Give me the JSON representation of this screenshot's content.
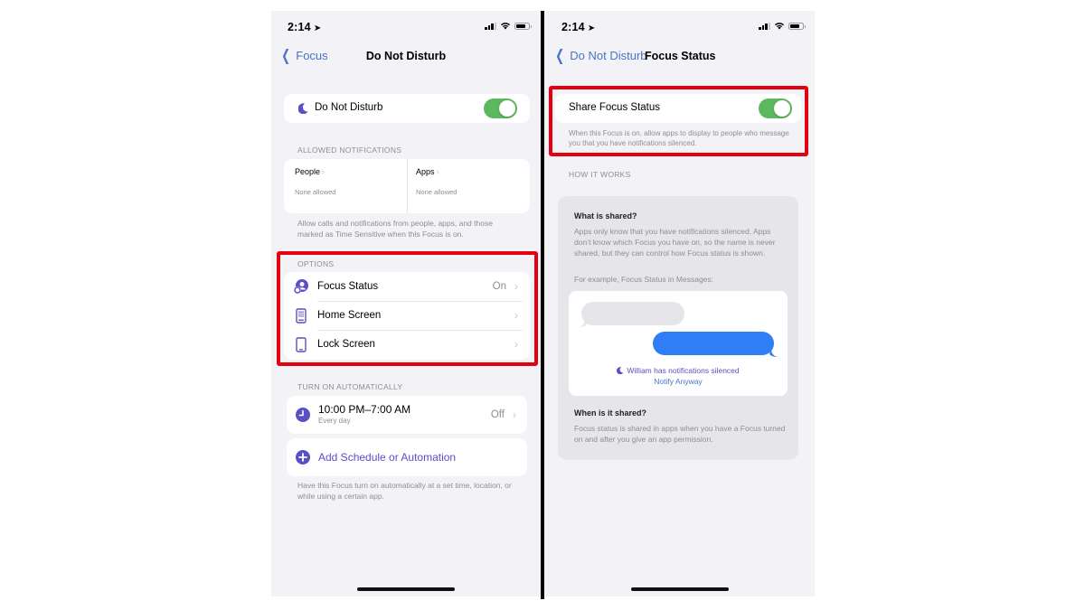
{
  "left_screen": {
    "status_bar": {
      "time": "2:14"
    },
    "nav": {
      "back_label": "Focus",
      "title": "Do Not Disturb"
    },
    "dnd_toggle": {
      "label": "Do Not Disturb",
      "on": true
    },
    "allowed_notifications": {
      "header": "ALLOWED NOTIFICATIONS",
      "people": {
        "label": "People",
        "value": "None allowed"
      },
      "apps": {
        "label": "Apps",
        "value": "None allowed"
      },
      "footer": "Allow calls and notifications from people, apps, and those marked as Time Sensitive when this Focus is on."
    },
    "options": {
      "header": "OPTIONS",
      "items": [
        {
          "label": "Focus Status",
          "value": "On",
          "icon": "focus-status-icon"
        },
        {
          "label": "Home Screen",
          "value": "",
          "icon": "home-screen-icon"
        },
        {
          "label": "Lock Screen",
          "value": "",
          "icon": "lock-screen-icon"
        }
      ]
    },
    "turn_on_automatically": {
      "header": "TURN ON AUTOMATICALLY",
      "schedule": {
        "title": "10:00 PM–7:00 AM",
        "subtitle": "Every day",
        "value": "Off"
      },
      "add_label": "Add Schedule or Automation",
      "footer": "Have this Focus turn on automatically at a set time, location, or while using a certain app."
    }
  },
  "right_screen": {
    "status_bar": {
      "time": "2:14"
    },
    "nav": {
      "back_label": "Do Not Disturb",
      "title": "Focus Status"
    },
    "share_toggle": {
      "label": "Share Focus Status",
      "on": true,
      "footer": "When this Focus is on, allow apps to display to people who message you that you have notifications silenced."
    },
    "how_it_works": {
      "header": "HOW IT WORKS",
      "what_title": "What is shared?",
      "what_body": "Apps only know that you have notifications silenced. Apps don’t know which Focus you have on, so the name is never shared, but they can control how Focus status is shown.",
      "example_label": "For example, Focus Status in Messages:",
      "silenced_text": "William has notifications silenced",
      "notify_anyway": "Notify Anyway",
      "when_title": "When is it shared?",
      "when_body": "Focus status is shared in apps when you have a Focus turned on and after you give an app permission."
    }
  },
  "colors": {
    "highlight": "#e3000f",
    "toggle_on": "#5cb85c",
    "link": "#4a74c9",
    "focus_purple": "#5a4fc4",
    "message_blue": "#2f7ef5"
  }
}
